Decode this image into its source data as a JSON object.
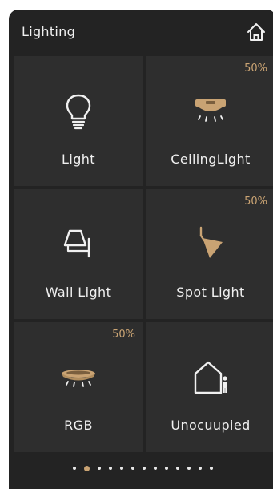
{
  "header": {
    "title": "Lighting",
    "home_icon": "home-icon"
  },
  "colors": {
    "accent": "#c9a373",
    "background": "#232323",
    "tile": "#2e2e2e",
    "text": "#f0f0f0"
  },
  "tiles": [
    {
      "label": "Light",
      "percent": "",
      "icon": "bulb-icon"
    },
    {
      "label": "CeilingLight",
      "percent": "50%",
      "icon": "ceiling-light-icon"
    },
    {
      "label": "Wall Light",
      "percent": "",
      "icon": "wall-light-icon"
    },
    {
      "label": "Spot Light",
      "percent": "50%",
      "icon": "spot-light-icon"
    },
    {
      "label": "RGB",
      "percent": "50%",
      "icon": "rgb-light-icon"
    },
    {
      "label": "Unocuupied",
      "percent": "",
      "icon": "unoccupied-icon"
    }
  ],
  "pager": {
    "page_count": 13,
    "active_page": 2
  }
}
